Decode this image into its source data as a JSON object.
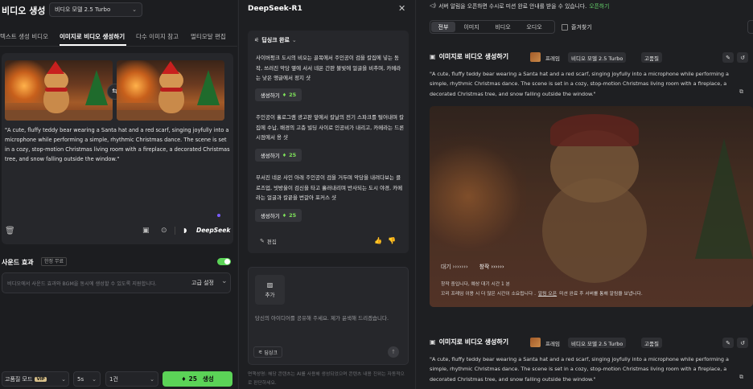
{
  "left": {
    "title": "비디오 생성",
    "model_select": "비디오 모델 2.5 Turbo",
    "tabs": [
      "텍스트 생성 비디오",
      "이미지로 비디오 생성하기",
      "다수 이미지 참고",
      "멀티모달 편집"
    ],
    "active_tab": 1,
    "prompt": "\"A cute, fluffy teddy bear wearing a Santa hat and a red scarf, singing joyfully into a microphone while performing a simple, rhythmic Christmas dance. The scene is set in a cozy, stop-motion Christmas living room with a fireplace, a decorated Christmas tree, and snow falling outside the window.\"",
    "deepseek_badge": "DeepSeek",
    "sound_effect_label": "사운드 효과",
    "sound_effect_badge": "한정 무료",
    "sound_placeholder": "비디오에서 사운드 효과와 BGM을 동시에 생성할 수 있도록 지원합니다.",
    "advanced_label": "고급 설정",
    "quality_mode": "고품질 모드",
    "vip_badge": "VIP",
    "duration": "5s",
    "count": "1건",
    "generate_cost": "25",
    "generate_label": "생성"
  },
  "mid": {
    "title": "DeepSeek-R1",
    "thinking_done": "딥싱크 완료",
    "suggestions": [
      {
        "text": "사이버펑크 도시의 비오는 골목에서 주인공이 검을 칼집에 넣는 동작, 쓰러진 악당 옆에 서서 네온 간판 불빛에 얼굴을 비추며, 카메라는 낮은 앵글에서 정지 샷",
        "btn": "생성하기",
        "cost": "25"
      },
      {
        "text": "주인공이 홀로그램 광고판 앞에서 칼날의 전기 스파크를 털어내며 칼집에 수납, 배경의 고층 빌딩 사이로 인공비가 내리고, 카메라는 드론 시점에서 용 샷",
        "btn": "생성하기",
        "cost": "25"
      },
      {
        "text": "부서진 네온 사인 아래 주인공이 검을 거두며 악당을 내려다보는 클로즈업, 빗방울이 검신을 타고 흘러내리며 반사되는 도시 야경, 카메라는 얼굴과 칼끝을 번갈아 포커스 샷",
        "btn": "생성하기",
        "cost": "25"
      }
    ],
    "edit_label": "편집",
    "add_label": "추가",
    "input_placeholder": "당신의 아이디어를 공유해 주세요. 제가 윤색해 드리겠습니다.",
    "deepthink_label": "딥싱크",
    "disclaimer": "면책성명: 해당 콘텐츠는 AI를 사용해 생성되었으며 콘텐츠 내용 진위는 자동적으로 판단하세요."
  },
  "right": {
    "notice": "서버 알림을 오픈하면 수시로 미션 완료 안내를 받을 수 있습니다.",
    "notice_link": "오픈하기",
    "filters": [
      "전부",
      "이미지",
      "비디오",
      "오디오"
    ],
    "active_filter": 0,
    "favorites_label": "즐겨찾기",
    "cards": [
      {
        "title": "이미지로 비디오 생성하기",
        "chips": [
          "프레임",
          "비디오 모델 2.5 Turbo",
          "고품질"
        ],
        "prompt": "\"A cute, fluffy teddy bear wearing a Santa hat and a red scarf, singing joyfully into a microphone while performing a simple, rhythmic Christmas dance. The scene is set in a cozy, stop-motion Christmas living room with a fireplace, a decorated Christmas tree, and snow falling outside the window.\"",
        "queue_label": "대기 ›››››››",
        "create_label": "창작 ››››››",
        "status_line1": "창작 중입니다, 예상 대기 시간 1 분",
        "status_line2_a": "꼬리 프레임 이용 시 더 많은 시간이 소요됩니다 .",
        "status_link": "알림 오픈",
        "status_line2_b": "미션 완료 후 서버를 통해 알림을 보냅니다."
      },
      {
        "title": "이미지로 비디오 생성하기",
        "chips": [
          "프레임",
          "비디오 모델 2.5 Turbo",
          "고품질"
        ],
        "prompt": "\"A cute, fluffy teddy bear wearing a Santa hat and a red scarf, singing joyfully into a microphone while performing a simple, rhythmic Christmas dance. The scene is set in a cozy, stop-motion Christmas living room with a fireplace, a decorated Christmas tree, and snow falling outside the window.\""
      }
    ]
  },
  "colors": {
    "accent": "#7ee05a",
    "generate_btn": "#5bd357",
    "link": "#66d36b",
    "purple_dot": "#7b5cff"
  }
}
